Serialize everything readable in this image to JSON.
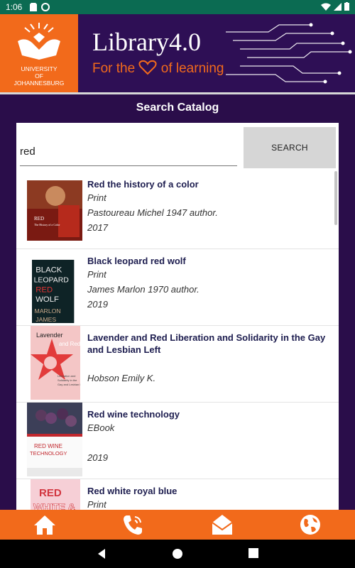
{
  "status": {
    "time": "1:06"
  },
  "header": {
    "university": [
      "UNIVERSITY",
      "OF",
      "JOHANNESBURG"
    ],
    "brand_title": "Library4.0",
    "brand_tagline_pre": "For the",
    "brand_tagline_post": "of learning",
    "accent_color": "#f26a1b"
  },
  "page": {
    "title": "Search Catalog"
  },
  "search": {
    "query": "red",
    "button_label": "SEARCH"
  },
  "results": [
    {
      "title": "Red the history of a color",
      "format": "Print",
      "author": "Pastoureau Michel 1947 author.",
      "year": "2017",
      "cover_text": "RED",
      "cover_sub": "The History of a Color"
    },
    {
      "title": "Black leopard red wolf",
      "format": "Print",
      "author": "James Marlon 1970 author.",
      "year": "2019",
      "cover_text": "BLACK LEOPARD RED WOLF",
      "cover_sub": "MARLON JAMES"
    },
    {
      "title": "Lavender and Red Liberation and Solidarity in the Gay and Lesbian Left",
      "format": "",
      "author": "Hobson Emily K.",
      "year": "",
      "cover_text": "Lavender and Red",
      "cover_sub": ""
    },
    {
      "title": "Red wine technology",
      "format": "EBook",
      "author": "",
      "year": "2019",
      "cover_text": "RED WINE TECHNOLOGY",
      "cover_sub": ""
    },
    {
      "title": "Red white royal blue",
      "format": "Print",
      "author": "",
      "year": "",
      "cover_text": "RED WHITE &",
      "cover_sub": ""
    }
  ],
  "nav": {
    "items": [
      "home-icon",
      "phone-icon",
      "mail-icon",
      "globe-icon"
    ]
  }
}
